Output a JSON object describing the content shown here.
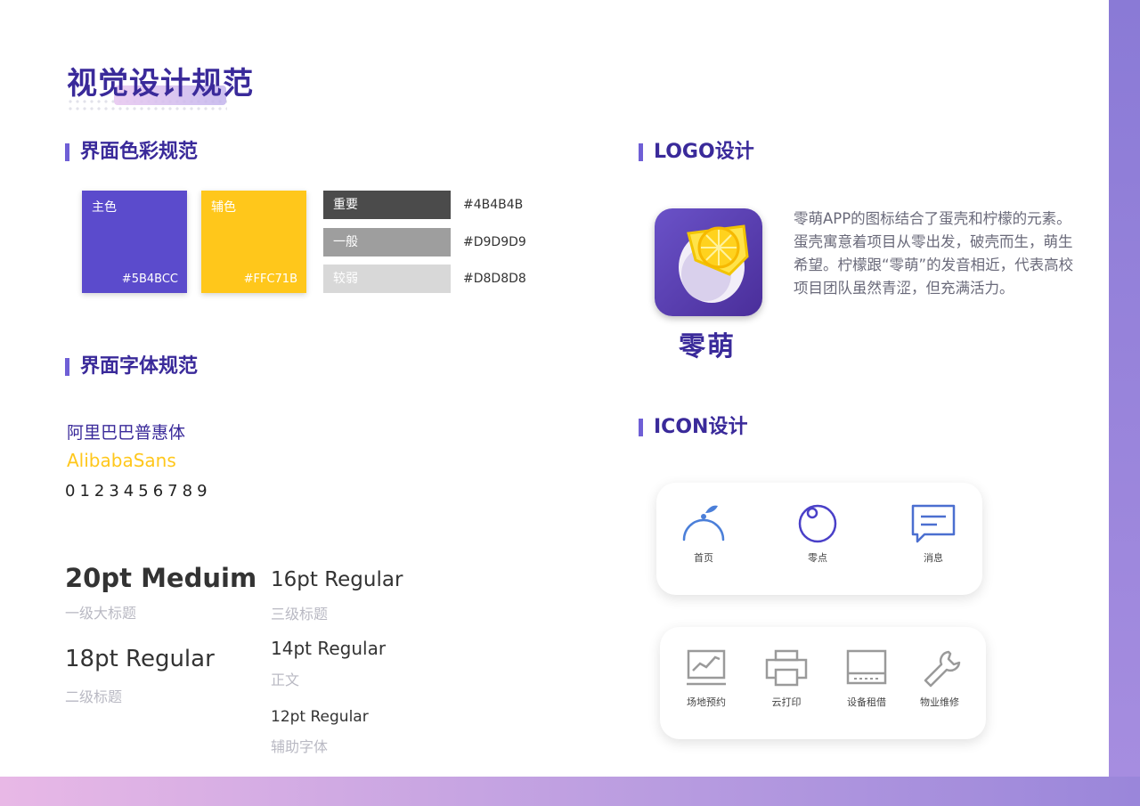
{
  "page": {
    "title": "视觉设计规范"
  },
  "sections": {
    "color": "界面色彩规范",
    "font": "界面字体规范",
    "logo": "LOGO设计",
    "icon": "ICON设计"
  },
  "colors": {
    "primary": {
      "label": "主色",
      "hex": "#5B4BCC",
      "value": "#5b4bcc"
    },
    "secondary": {
      "label": "辅色",
      "hex": "#FFC71B",
      "value": "#ffc71b"
    },
    "grays": [
      {
        "label": "重要",
        "hex": "#4B4B4B",
        "value": "#4b4b4b"
      },
      {
        "label": "一般",
        "hex": "#D9D9D9",
        "value": "#9e9e9e"
      },
      {
        "label": "较弱",
        "hex": "#D8D8D8",
        "value": "#d8d8d8"
      }
    ]
  },
  "fonts": {
    "name_cn": "阿里巴巴普惠体",
    "name_en": "AlibabaSans",
    "digits": "0123456789"
  },
  "typography": [
    {
      "spec": "20pt Meduim",
      "usage": "一级大标题"
    },
    {
      "spec": "18pt Regular",
      "usage": "二级标题"
    },
    {
      "spec": "16pt Regular",
      "usage": "三级标题"
    },
    {
      "spec": "14pt Regular",
      "usage": "正文"
    },
    {
      "spec": "12pt Regular",
      "usage": "辅助字体"
    }
  ],
  "logo": {
    "text": "零萌",
    "description": "零萌APP的图标结合了蛋壳和柠檬的元素。\n蛋壳寓意着项目从零出发，破壳而生，萌生希望。柠檬跟“零萌”的发音相近，代表高校项目团队虽然青涩，但充满活力。"
  },
  "icons": {
    "nav": [
      {
        "label": "首页",
        "icon": "lemon-home-icon"
      },
      {
        "label": "零点",
        "icon": "zero-circle-icon"
      },
      {
        "label": "消息",
        "icon": "message-icon"
      }
    ],
    "service": [
      {
        "label": "场地预约",
        "icon": "monitor-chart-icon"
      },
      {
        "label": "云打印",
        "icon": "printer-icon"
      },
      {
        "label": "设备租借",
        "icon": "device-icon"
      },
      {
        "label": "物业维修",
        "icon": "wrench-icon"
      }
    ]
  }
}
